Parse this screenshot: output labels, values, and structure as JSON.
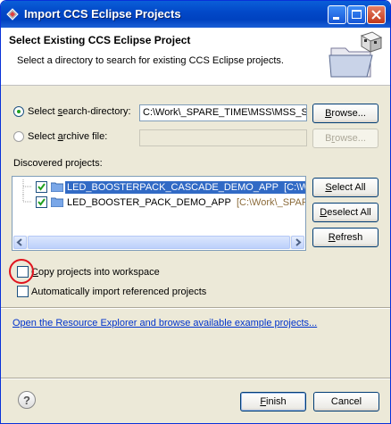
{
  "window": {
    "title": "Import CCS Eclipse Projects",
    "header_title": "Select Existing CCS Eclipse Project",
    "header_desc": "Select a directory to search for existing CCS Eclipse projects."
  },
  "search": {
    "dir_radio_label": "Select search-directory:",
    "dir_value": "C:\\Work\\_SPARE_TIME\\MSS\\MSS_SR",
    "archive_radio_label": "Select archive file:",
    "archive_value": "",
    "browse_label": "Browse..."
  },
  "projects": {
    "section_label": "Discovered projects:",
    "items": [
      {
        "name": "LED_BOOSTERPACK_CASCADE_DEMO_APP",
        "path": "[C:\\Work\\_",
        "checked": true,
        "selected": true
      },
      {
        "name": "LED_BOOSTER_PACK_DEMO_APP",
        "path": "[C:\\Work\\_SPARE_T",
        "checked": true,
        "selected": false
      }
    ],
    "select_all_label": "Select All",
    "deselect_all_label": "Deselect All",
    "refresh_label": "Refresh"
  },
  "options": {
    "copy_label": "Copy projects into workspace",
    "copy_checked": false,
    "auto_import_label": "Automatically import referenced projects",
    "auto_import_checked": false
  },
  "resource_link": "Open the Resource Explorer and browse available example projects...",
  "footer": {
    "finish_label": "Finish",
    "cancel_label": "Cancel",
    "help_label": "?"
  },
  "colors": {
    "selection": "#316ac5",
    "titlebar": "#0042c0",
    "annotation_circle": "#e0141e",
    "link": "#0033cc"
  }
}
